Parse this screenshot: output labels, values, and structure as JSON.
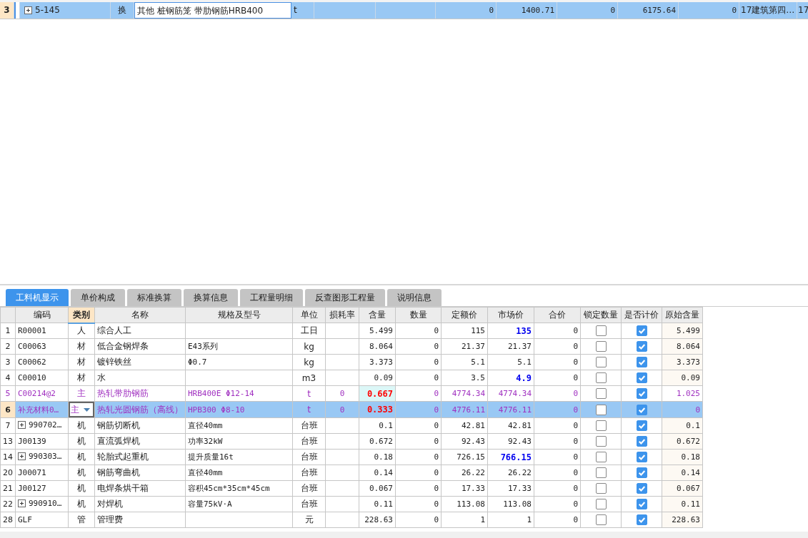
{
  "top_row": {
    "no": "3",
    "expandable": true,
    "code": "5-145",
    "type": "换",
    "name": "其他 桩钢筋笼 带肋钢筋HRB400",
    "unit": "t",
    "values": [
      "0",
      "1400.71",
      "0",
      "6175.64",
      "0"
    ],
    "note": "17建筑第四…",
    "extra": "17"
  },
  "tabs": [
    {
      "label": "工料机显示",
      "selected": true
    },
    {
      "label": "单价构成",
      "selected": false
    },
    {
      "label": "标准换算",
      "selected": false
    },
    {
      "label": "换算信息",
      "selected": false
    },
    {
      "label": "工程量明细",
      "selected": false
    },
    {
      "label": "反查图形工程量",
      "selected": false
    },
    {
      "label": "说明信息",
      "selected": false
    }
  ],
  "columns": [
    {
      "label": "编码",
      "selected": false
    },
    {
      "label": "类别",
      "selected": true
    },
    {
      "label": "名称",
      "selected": false
    },
    {
      "label": "规格及型号",
      "selected": false
    },
    {
      "label": "单位",
      "selected": false
    },
    {
      "label": "损耗率",
      "selected": false
    },
    {
      "label": "含量",
      "selected": false
    },
    {
      "label": "数量",
      "selected": false
    },
    {
      "label": "定额价",
      "selected": false
    },
    {
      "label": "市场价",
      "selected": false
    },
    {
      "label": "合价",
      "selected": false
    },
    {
      "label": "锁定数量",
      "selected": false
    },
    {
      "label": "是否计价",
      "selected": false
    },
    {
      "label": "原始含量",
      "selected": false
    }
  ],
  "rows": [
    {
      "no": "1",
      "code": "R00001",
      "expandable": false,
      "category": "人",
      "name": "综合人工",
      "spec": "",
      "unit": "工日",
      "loss": "",
      "content": "5.499",
      "quantity": "0",
      "quota_price": "115",
      "market_price": "135",
      "market_adjusted": true,
      "total": "0",
      "locked": false,
      "priced": true,
      "original": "5.499",
      "kind": "normal",
      "selected": false
    },
    {
      "no": "2",
      "code": "C00063",
      "expandable": false,
      "category": "材",
      "name": "低合金钢焊条",
      "spec": "E43系列",
      "unit": "kg",
      "loss": "",
      "content": "8.064",
      "quantity": "0",
      "quota_price": "21.37",
      "market_price": "21.37",
      "market_adjusted": false,
      "total": "0",
      "locked": false,
      "priced": true,
      "original": "8.064",
      "kind": "normal",
      "selected": false
    },
    {
      "no": "3",
      "code": "C00062",
      "expandable": false,
      "category": "材",
      "name": "镀锌铁丝",
      "spec": "Φ0.7",
      "unit": "kg",
      "loss": "",
      "content": "3.373",
      "quantity": "0",
      "quota_price": "5.1",
      "market_price": "5.1",
      "market_adjusted": false,
      "total": "0",
      "locked": false,
      "priced": true,
      "original": "3.373",
      "kind": "normal",
      "selected": false
    },
    {
      "no": "4",
      "code": "C00010",
      "expandable": false,
      "category": "材",
      "name": "水",
      "spec": "",
      "unit": "m3",
      "loss": "",
      "content": "0.09",
      "quantity": "0",
      "quota_price": "3.5",
      "market_price": "4.9",
      "market_adjusted": true,
      "total": "0",
      "locked": false,
      "priced": true,
      "original": "0.09",
      "kind": "normal",
      "selected": false
    },
    {
      "no": "5",
      "code": "C00214@2",
      "expandable": false,
      "category": "主",
      "name": "热轧带肋钢筋",
      "spec": "HRB400E Φ12-14",
      "unit": "t",
      "loss": "0",
      "content": "0.667",
      "quantity": "0",
      "quota_price": "4774.34",
      "market_price": "4774.34",
      "market_adjusted": false,
      "total": "0",
      "locked": false,
      "priced": true,
      "original": "1.025",
      "kind": "main",
      "selected": false
    },
    {
      "no": "6",
      "code": "补充材料0…",
      "expandable": false,
      "category": "主",
      "name": "热轧光圆钢筋（高线）",
      "spec": "HPB300 Φ8-10",
      "unit": "t",
      "loss": "0",
      "content": "0.333",
      "quantity": "0",
      "quota_price": "4776.11",
      "market_price": "4776.11",
      "market_adjusted": false,
      "total": "0",
      "locked": false,
      "priced": true,
      "original": "0",
      "kind": "main",
      "selected": true
    },
    {
      "no": "7",
      "code": "990702…",
      "expandable": true,
      "category": "机",
      "name": "钢筋切断机",
      "spec": "直径40mm",
      "unit": "台班",
      "loss": "",
      "content": "0.1",
      "quantity": "0",
      "quota_price": "42.81",
      "market_price": "42.81",
      "market_adjusted": false,
      "total": "0",
      "locked": false,
      "priced": true,
      "original": "0.1",
      "kind": "normal",
      "selected": false
    },
    {
      "no": "13",
      "code": "J00139",
      "expandable": false,
      "category": "机",
      "name": "直流弧焊机",
      "spec": "功率32kW",
      "unit": "台班",
      "loss": "",
      "content": "0.672",
      "quantity": "0",
      "quota_price": "92.43",
      "market_price": "92.43",
      "market_adjusted": false,
      "total": "0",
      "locked": false,
      "priced": true,
      "original": "0.672",
      "kind": "normal",
      "selected": false
    },
    {
      "no": "14",
      "code": "990303…",
      "expandable": true,
      "category": "机",
      "name": "轮胎式起重机",
      "spec": "提升质量16t",
      "unit": "台班",
      "loss": "",
      "content": "0.18",
      "quantity": "0",
      "quota_price": "726.15",
      "market_price": "766.15",
      "market_adjusted": true,
      "total": "0",
      "locked": false,
      "priced": true,
      "original": "0.18",
      "kind": "normal",
      "selected": false
    },
    {
      "no": "20",
      "code": "J00071",
      "expandable": false,
      "category": "机",
      "name": "钢筋弯曲机",
      "spec": "直径40mm",
      "unit": "台班",
      "loss": "",
      "content": "0.14",
      "quantity": "0",
      "quota_price": "26.22",
      "market_price": "26.22",
      "market_adjusted": false,
      "total": "0",
      "locked": false,
      "priced": true,
      "original": "0.14",
      "kind": "normal",
      "selected": false
    },
    {
      "no": "21",
      "code": "J00127",
      "expandable": false,
      "category": "机",
      "name": "电焊条烘干箱",
      "spec": "容积45cm*35cm*45cm",
      "unit": "台班",
      "loss": "",
      "content": "0.067",
      "quantity": "0",
      "quota_price": "17.33",
      "market_price": "17.33",
      "market_adjusted": false,
      "total": "0",
      "locked": false,
      "priced": true,
      "original": "0.067",
      "kind": "normal",
      "selected": false
    },
    {
      "no": "22",
      "code": "990910…",
      "expandable": true,
      "category": "机",
      "name": "对焊机",
      "spec": "容量75kV·A",
      "unit": "台班",
      "loss": "",
      "content": "0.11",
      "quantity": "0",
      "quota_price": "113.08",
      "market_price": "113.08",
      "market_adjusted": false,
      "total": "0",
      "locked": false,
      "priced": true,
      "original": "0.11",
      "kind": "normal",
      "selected": false
    },
    {
      "no": "28",
      "code": "GLF",
      "expandable": false,
      "category": "管",
      "name": "管理费",
      "spec": "",
      "unit": "元",
      "loss": "",
      "content": "228.63",
      "quantity": "0",
      "quota_price": "1",
      "market_price": "1",
      "market_adjusted": false,
      "total": "0",
      "locked": false,
      "priced": true,
      "original": "228.63",
      "kind": "normal",
      "selected": false
    }
  ]
}
